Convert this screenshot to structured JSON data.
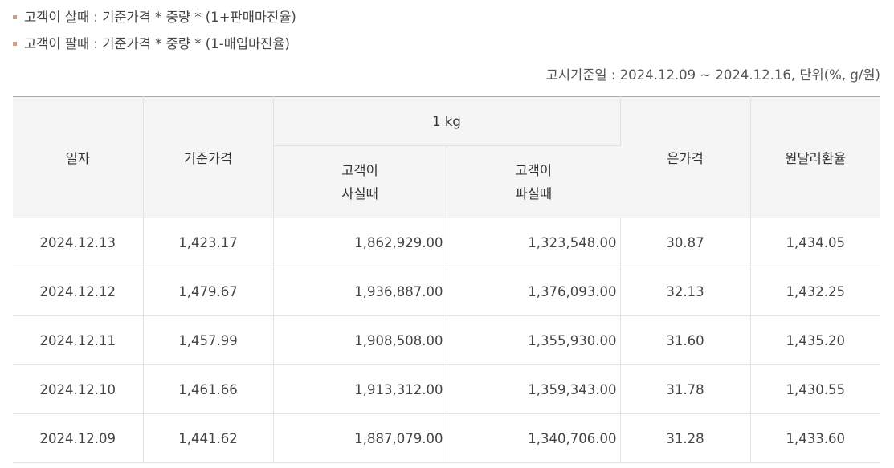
{
  "notes": {
    "buy": "고객이 살때 : 기준가격 * 중량 * (1+판매마진율)",
    "sell": "고객이 팔때 : 기준가격 * 중량 * (1-매입마진율)"
  },
  "notice": "고시기준일 : 2024.12.09 ~ 2024.12.16, 단위(%, g/원)",
  "table": {
    "headers": {
      "date": "일자",
      "base_price": "기준가격",
      "unit_group": "1 kg",
      "buy_line1": "고객이",
      "buy_line2": "사실때",
      "sell_line1": "고객이",
      "sell_line2": "파실때",
      "silver": "은가격",
      "fx": "원달러환율"
    },
    "rows": [
      {
        "date": "2024.12.13",
        "base": "1,423.17",
        "buy": "1,862,929.00",
        "sell": "1,323,548.00",
        "silver": "30.87",
        "fx": "1,434.05"
      },
      {
        "date": "2024.12.12",
        "base": "1,479.67",
        "buy": "1,936,887.00",
        "sell": "1,376,093.00",
        "silver": "32.13",
        "fx": "1,432.25"
      },
      {
        "date": "2024.12.11",
        "base": "1,457.99",
        "buy": "1,908,508.00",
        "sell": "1,355,930.00",
        "silver": "31.60",
        "fx": "1,435.20"
      },
      {
        "date": "2024.12.10",
        "base": "1,461.66",
        "buy": "1,913,312.00",
        "sell": "1,359,343.00",
        "silver": "31.78",
        "fx": "1,430.55"
      },
      {
        "date": "2024.12.09",
        "base": "1,441.62",
        "buy": "1,887,079.00",
        "sell": "1,340,706.00",
        "silver": "31.28",
        "fx": "1,433.60"
      }
    ]
  }
}
